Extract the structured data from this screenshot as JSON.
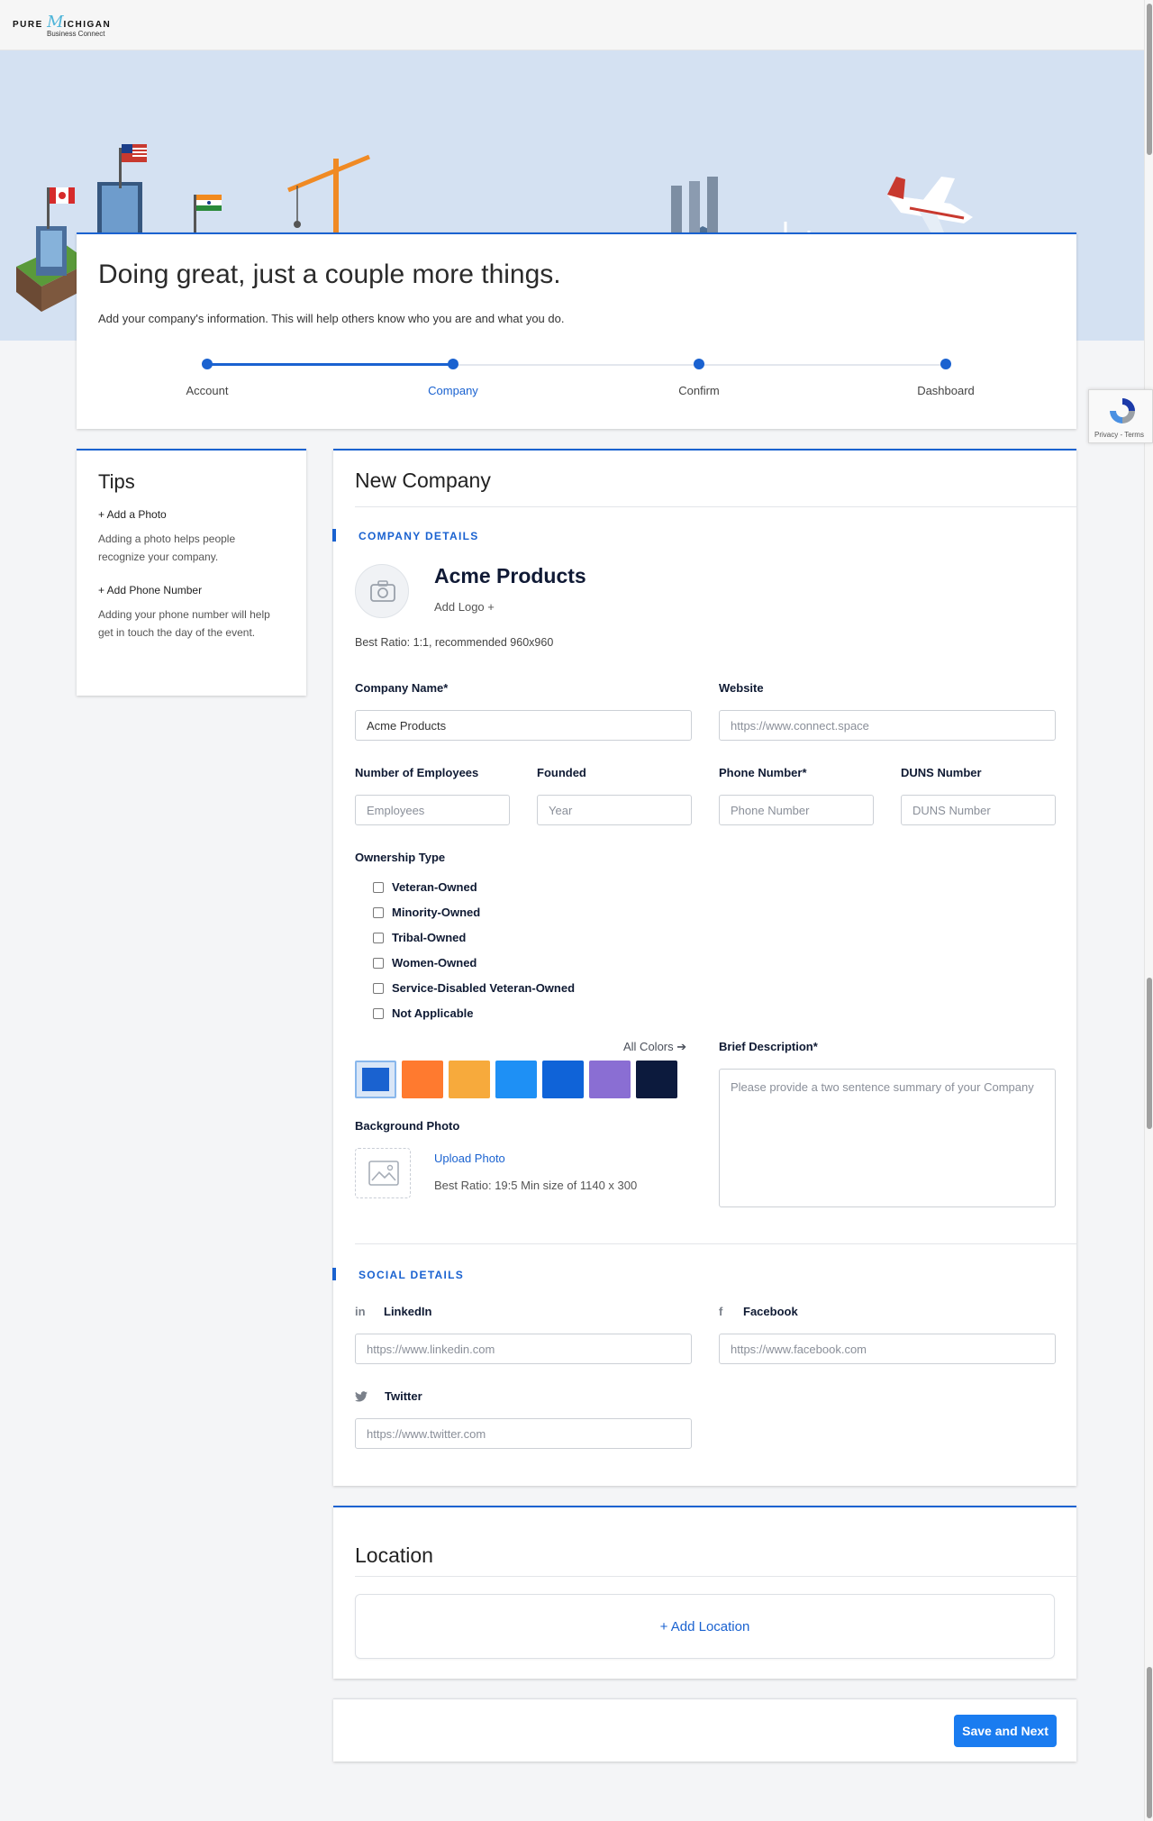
{
  "brand": {
    "logo_top": "PURE",
    "logo_script": "Michigan",
    "logo_right": "CHIGAN",
    "logo_bottom": "Business Connect"
  },
  "header": {
    "title": "Doing great, just a couple more things.",
    "subtitle": "Add your company's information. This will help others know who you are and what you do.",
    "steps": [
      "Account",
      "Company",
      "Confirm",
      "Dashboard"
    ],
    "active_step": "Company"
  },
  "recaptcha": {
    "text": "Privacy - Terms"
  },
  "tips": {
    "title": "Tips",
    "items": [
      {
        "heading": "+ Add a Photo",
        "text": "Adding a photo helps people recognize your company."
      },
      {
        "heading": "+ Add Phone Number",
        "text": "Adding your phone number will help get in touch the day of the event."
      }
    ]
  },
  "form": {
    "title": "New Company",
    "company_section": "COMPANY DETAILS",
    "company_name": "Acme Products",
    "add_logo": "Add Logo +",
    "ratio_note": "Best Ratio: 1:1, recommended 960x960",
    "fields": {
      "company_name_label": "Company Name*",
      "company_name_value": "Acme Products",
      "website_label": "Website",
      "website_placeholder": "https://www.connect.space",
      "employees_label": "Number of Employees",
      "employees_placeholder": "Employees",
      "founded_label": "Founded",
      "founded_placeholder": "Year",
      "phone_label": "Phone Number*",
      "phone_placeholder": "Phone Number",
      "duns_label": "DUNS Number",
      "duns_placeholder": "DUNS Number"
    },
    "ownership_label": "Ownership Type",
    "ownership_options": [
      "Veteran-Owned",
      "Minority-Owned",
      "Tribal-Owned",
      "Women-Owned",
      "Service-Disabled Veteran-Owned",
      "Not Applicable"
    ],
    "all_colors": "All Colors",
    "colors": [
      "#1a62d0",
      "#ff7a2f",
      "#f7aa3c",
      "#1e90f5",
      "#0f63d8",
      "#8a6ed3",
      "#0c1a3d"
    ],
    "selected_color": "#1a62d0",
    "description_label": "Brief Description*",
    "description_placeholder": "Please provide a two sentence summary of your Company",
    "background_label": "Background Photo",
    "upload_photo": "Upload Photo",
    "background_ratio": "Best Ratio: 19:5 Min size of 1140 x 300",
    "social_section": "SOCIAL DETAILS",
    "linkedin_label": "LinkedIn",
    "linkedin_placeholder": "https://www.linkedin.com",
    "facebook_label": "Facebook",
    "facebook_placeholder": "https://www.facebook.com",
    "twitter_label": "Twitter",
    "twitter_placeholder": "https://www.twitter.com"
  },
  "location": {
    "title": "Location",
    "add_label": "+ Add Location"
  },
  "footer": {
    "save_label": "Save and Next"
  },
  "accent_color": "#1a62d0"
}
